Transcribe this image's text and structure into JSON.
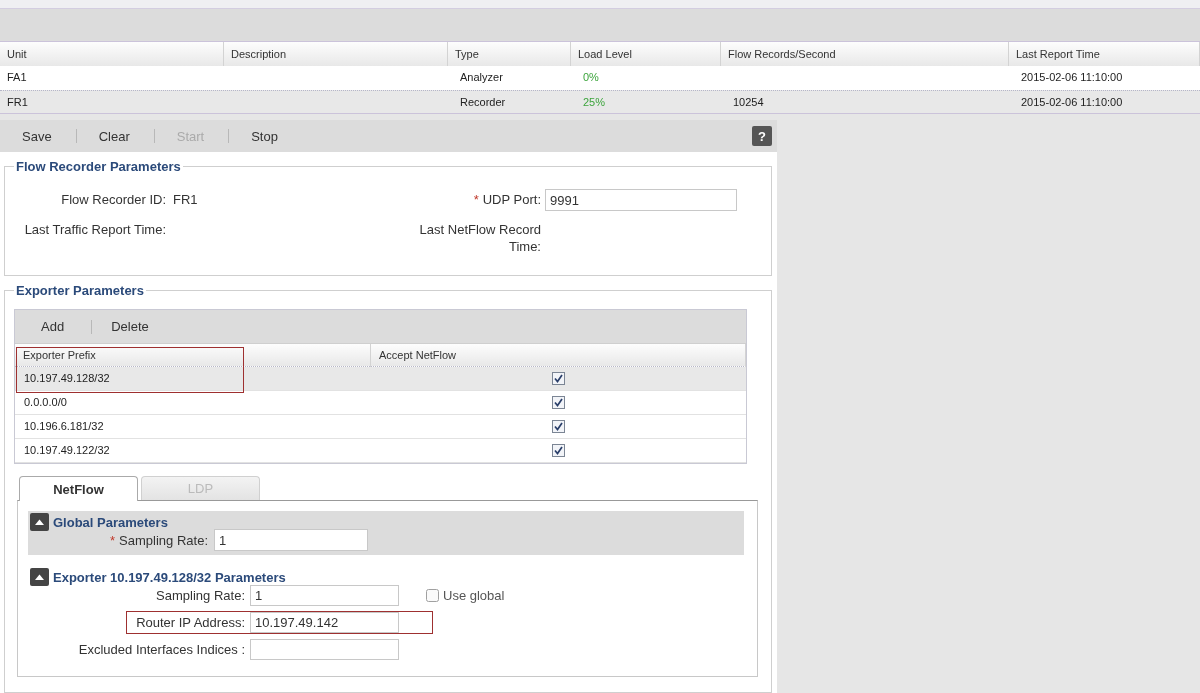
{
  "units_table": {
    "columns": [
      "Unit",
      "Description",
      "Type",
      "Load Level",
      "Flow Records/Second",
      "Last Report Time"
    ],
    "rows": [
      {
        "unit": "FA1",
        "type": "Analyzer",
        "load_level": "0%",
        "last_report_time": "2015-02-06 11:10:00",
        "selected": false
      },
      {
        "unit": "FR1",
        "type": "Recorder",
        "load_level": "25%",
        "flow_records_per_second": "10254",
        "last_report_time": "2015-02-06 11:10:00",
        "selected": true
      }
    ]
  },
  "toolbar": {
    "buttons": [
      {
        "label": "Save",
        "disabled": false
      },
      {
        "label": "Clear",
        "disabled": false
      },
      {
        "label": "Start",
        "disabled": true
      },
      {
        "label": "Stop",
        "disabled": false
      }
    ],
    "help": "?"
  },
  "flow_recorder_parameters": {
    "title": "Flow Recorder Parameters",
    "fields": [
      {
        "kind": "readonly",
        "label": "Flow Recorder ID:",
        "value": "FR1"
      },
      {
        "kind": "input",
        "required_mark": "*",
        "label": "UDP Port:",
        "value": "9991"
      },
      {
        "kind": "readonly",
        "label": "Last Traffic Report Time:"
      },
      {
        "kind": "readonly",
        "label": "Last NetFlow Record Time:"
      }
    ]
  },
  "exporter_parameters": {
    "title": "Exporter Parameters",
    "toolbar": [
      "Add",
      "Delete"
    ],
    "table": {
      "columns": [
        {
          "label": "Exporter Prefix",
          "highlighted": true
        },
        {
          "label": "Accept NetFlow",
          "highlighted": false
        }
      ],
      "rows": [
        {
          "prefix": "10.197.49.128/32",
          "accept_netflow": true,
          "selected": true
        },
        {
          "prefix": "0.0.0.0/0",
          "accept_netflow": true,
          "selected": false
        },
        {
          "prefix": "10.196.6.181/32",
          "accept_netflow": true,
          "selected": false
        },
        {
          "prefix": "10.197.49.122/32",
          "accept_netflow": true,
          "selected": false
        }
      ]
    },
    "tabs": [
      {
        "label": "NetFlow",
        "selected": true
      },
      {
        "label": "LDP",
        "selected": false
      }
    ],
    "global_parameters": {
      "title": "Global Parameters",
      "expanded": true,
      "fields": [
        {
          "kind": "input",
          "required_mark": "*",
          "label": "Sampling Rate:",
          "value": "1",
          "highlighted": false
        }
      ]
    },
    "exporter_section": {
      "title": "Exporter 10.197.49.128/32 Parameters",
      "expanded": true,
      "fields": [
        {
          "kind": "input",
          "label": "Sampling Rate:",
          "value": "1",
          "highlighted": false,
          "option": {
            "label": "Use global",
            "checked": false
          }
        },
        {
          "kind": "input",
          "label": "Router IP Address:",
          "value": "10.197.49.142",
          "highlighted": true
        },
        {
          "kind": "input",
          "label": "Excluded Interfaces Indices :",
          "highlighted": false
        }
      ]
    }
  }
}
